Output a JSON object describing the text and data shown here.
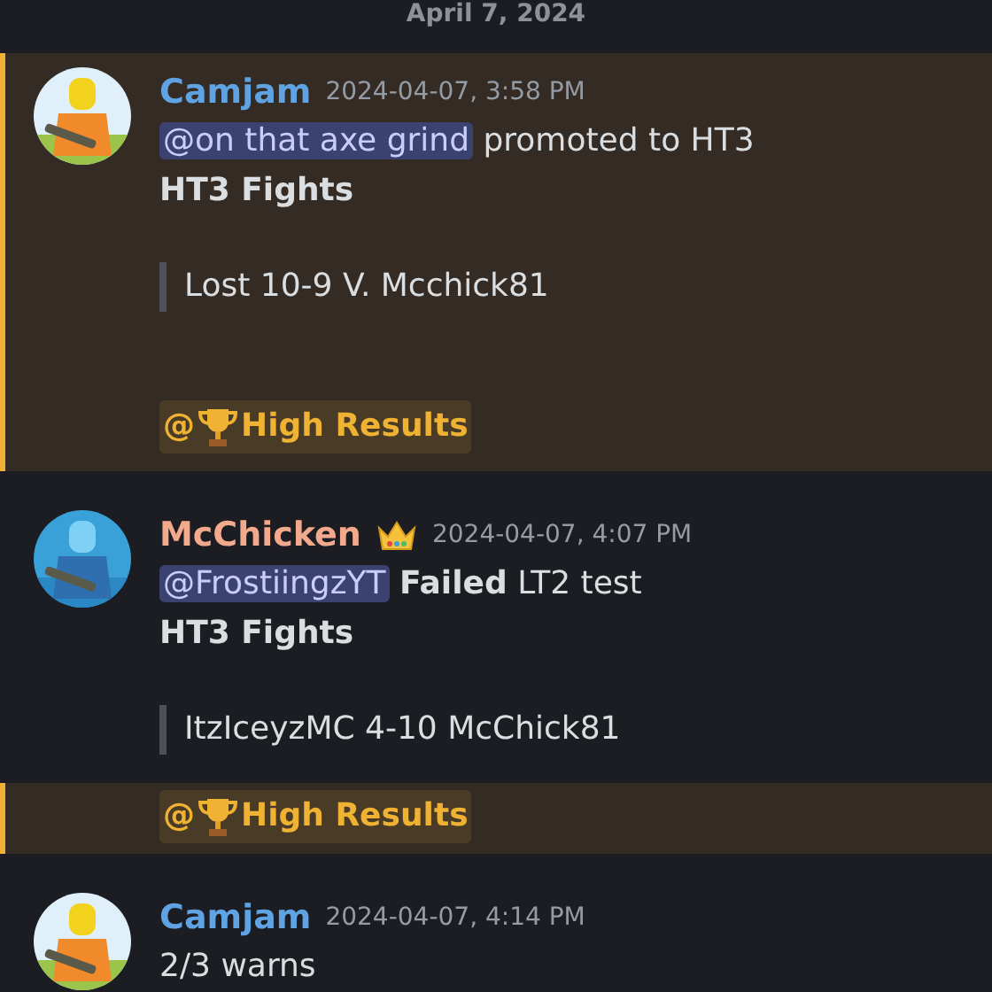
{
  "date_divider": "April 7, 2024",
  "messages": [
    {
      "kind": "full",
      "highlighted": true,
      "author": "Camjam",
      "color": "#5fa3e3",
      "avatar": {
        "kind": "picture"
      },
      "badge": false,
      "timestamp": "2024-04-07, 3:58 PM",
      "lines": [
        {
          "kind": "text",
          "parts": [
            {
              "kind": "mention",
              "text": "@on that axe grind"
            },
            {
              "kind": "text",
              "text": " promoted to HT3"
            }
          ]
        },
        {
          "kind": "bold",
          "text": "HT3 Fights"
        },
        {
          "kind": "quote",
          "text": "Lost 10-9 V. Mcchick81"
        },
        {
          "kind": "role",
          "prefix": "@",
          "name": "High Results"
        }
      ]
    },
    {
      "kind": "full",
      "highlighted": false,
      "author": "McChicken",
      "color": "#f3a98c",
      "avatar": {
        "kind": "picture"
      },
      "badge": true,
      "timestamp": "2024-04-07, 4:07 PM",
      "lines": [
        {
          "kind": "text",
          "parts": [
            {
              "kind": "mention",
              "text": "@FrostiingzYT"
            },
            {
              "kind": "text",
              "text": " **Failed** LT2 test"
            }
          ]
        },
        {
          "kind": "bold",
          "text": "HT3 Fights"
        },
        {
          "kind": "quote",
          "text": "ItzIceyzMC 4-10 McChick81"
        }
      ]
    },
    {
      "kind": "continuation",
      "highlighted": true,
      "lines": [
        {
          "kind": "role",
          "prefix": "@",
          "name": "High Results"
        }
      ]
    },
    {
      "kind": "full",
      "highlighted": false,
      "author": "Camjam",
      "color": "#5fa3e3",
      "avatar": {
        "kind": "picture"
      },
      "badge": false,
      "timestamp": "2024-04-07, 4:14 PM",
      "lines": [
        {
          "kind": "plain",
          "text": "2/3 warns"
        }
      ]
    }
  ]
}
